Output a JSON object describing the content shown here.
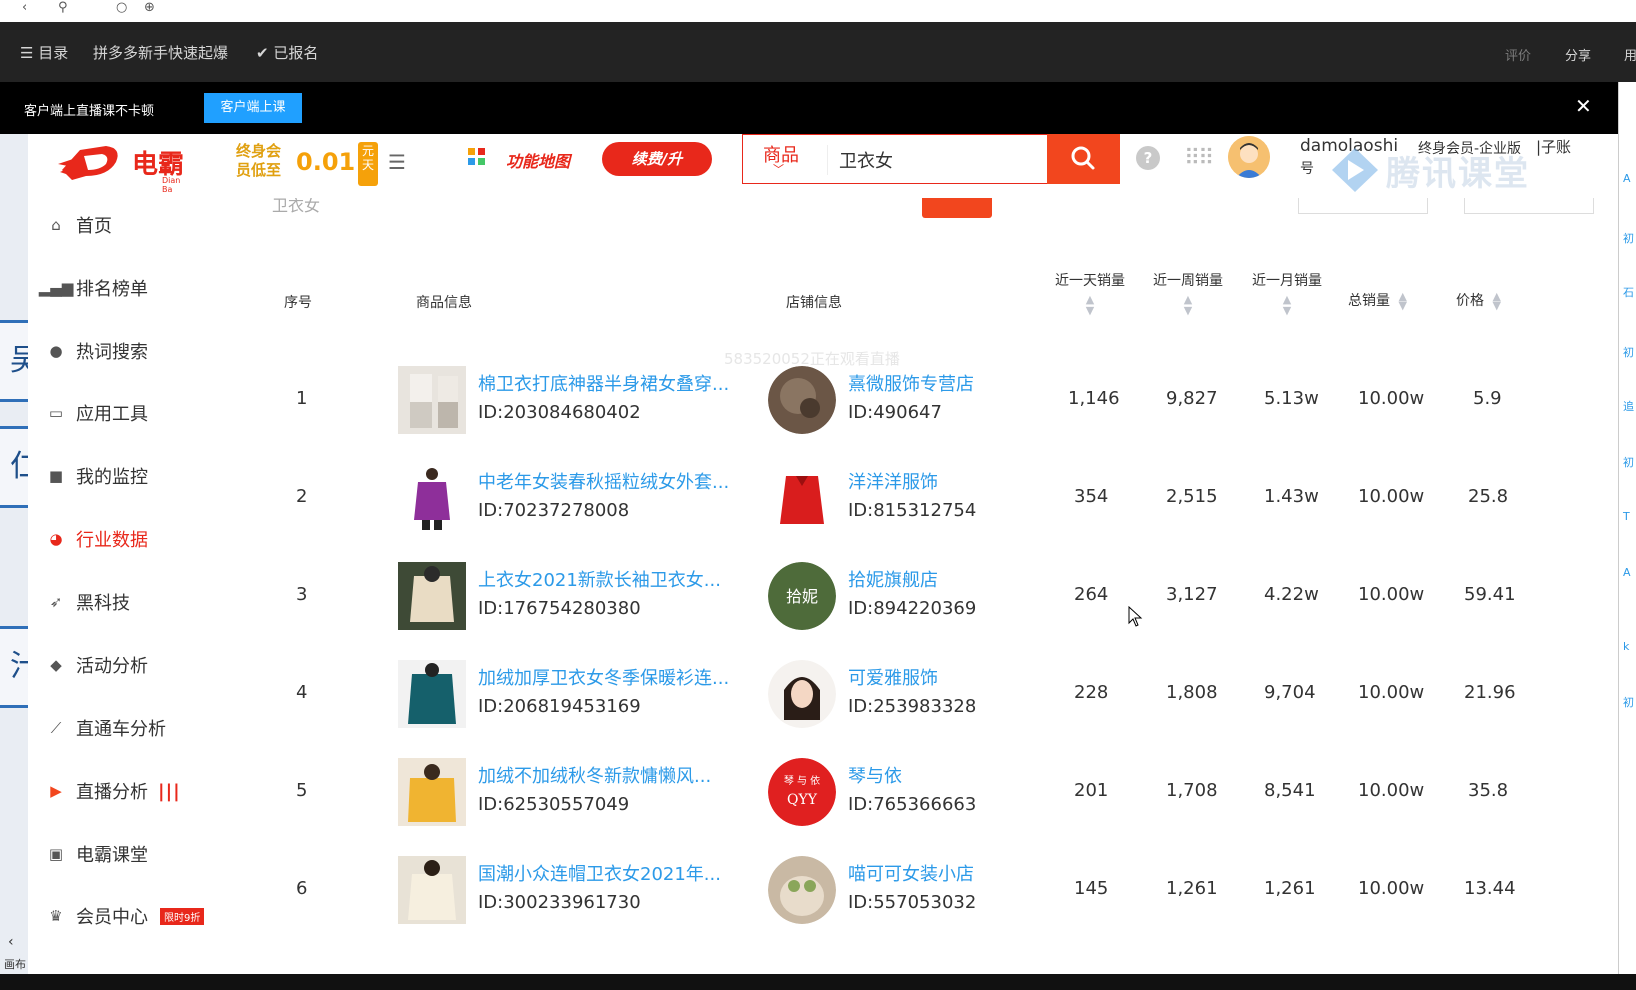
{
  "course_bar": {
    "menu": "☰ 目录",
    "title": "拼多多新手快速起爆",
    "signed": "✔ 已报名",
    "rate": "评价",
    "share": "分享",
    "more": "用"
  },
  "live_bar": {
    "tip": "客户端上直播课不卡顿",
    "button": "客户端上课",
    "close": "✕"
  },
  "left_deco": {
    "blocks": [
      "吴",
      "仁",
      "汁"
    ],
    "painting": "画布"
  },
  "header": {
    "logo_text": "电霸",
    "logo_sub": "Dian  Ba",
    "promo_line": "终身会员低至",
    "promo_price": "0.01",
    "promo_unit": "元天",
    "function_map": "功能地图",
    "renew": "续费/升",
    "search_category": "商品",
    "search_value": "卫衣女",
    "help": "?",
    "username": "damolaoshi",
    "username_suffix": "号",
    "vip": "终身会员-企业版",
    "sub_account": "|子账",
    "watermark": "腾讯课堂"
  },
  "ghost": {
    "search_echo": "卫衣女"
  },
  "sidebar": {
    "items": [
      {
        "label": "首页",
        "icon": "home-icon"
      },
      {
        "label": "排名榜单",
        "icon": "bar-chart-icon"
      },
      {
        "label": "热词搜索",
        "icon": "flame-icon"
      },
      {
        "label": "应用工具",
        "icon": "monitor-icon"
      },
      {
        "label": "我的监控",
        "icon": "camera-icon"
      },
      {
        "label": "行业数据",
        "icon": "pie-chart-icon"
      },
      {
        "label": "黑科技",
        "icon": "rocket-icon"
      },
      {
        "label": "活动分析",
        "icon": "tag-icon"
      },
      {
        "label": "直通车分析",
        "icon": "line-chart-icon"
      },
      {
        "label": "直播分析",
        "icon": "tv-icon",
        "badge": "|||"
      },
      {
        "label": "电霸课堂",
        "icon": "play-icon"
      },
      {
        "label": "会员中心",
        "icon": "crown-icon",
        "badge": "限时9折"
      }
    ],
    "active_index": 5
  },
  "table": {
    "headers": {
      "index": "序号",
      "product": "商品信息",
      "shop": "店铺信息",
      "day": "近一天销量",
      "week": "近一周销量",
      "month": "近一月销量",
      "total": "总销量",
      "price": "价格"
    },
    "watermark": "583520052正在观看直播",
    "rows": [
      {
        "index": "1",
        "name": "棉卫衣打底神器半身裙女叠穿...",
        "id": "ID:203084680402",
        "shop": "熹微服饰专营店",
        "shop_id": "ID:490647",
        "day": "1,146",
        "week": "9,827",
        "month": "5.13w",
        "total": "10.00w",
        "price": "5.9"
      },
      {
        "index": "2",
        "name": "中老年女装春秋摇粒绒女外套...",
        "id": "ID:70237278008",
        "shop": "洋洋洋服饰",
        "shop_id": "ID:815312754",
        "day": "354",
        "week": "2,515",
        "month": "1.43w",
        "total": "10.00w",
        "price": "25.8"
      },
      {
        "index": "3",
        "name": "上衣女2021新款长袖卫衣女...",
        "id": "ID:176754280380",
        "shop": "拾妮旗舰店",
        "shop_id": "ID:894220369",
        "day": "264",
        "week": "3,127",
        "month": "4.22w",
        "total": "10.00w",
        "price": "59.41"
      },
      {
        "index": "4",
        "name": "加绒加厚卫衣女冬季保暖衫连...",
        "id": "ID:206819453169",
        "shop": "可爱雅服饰",
        "shop_id": "ID:253983328",
        "day": "228",
        "week": "1,808",
        "month": "9,704",
        "total": "10.00w",
        "price": "21.96"
      },
      {
        "index": "5",
        "name": "加绒不加绒秋冬新款慵懒风...",
        "id": "ID:62530557049",
        "shop": "琴与依",
        "shop_id": "ID:765366663",
        "day": "201",
        "week": "1,708",
        "month": "8,541",
        "total": "10.00w",
        "price": "35.8"
      },
      {
        "index": "6",
        "name": "国潮小众连帽卫衣女2021年...",
        "id": "ID:300233961730",
        "shop": "喵可可女装小店",
        "shop_id": "ID:557053032",
        "day": "145",
        "week": "1,261",
        "month": "1,261",
        "total": "10.00w",
        "price": "13.44"
      }
    ]
  },
  "colors": {
    "brand_red": "#e8281b",
    "link_blue": "#2c9ae8",
    "search_orange": "#f2461e",
    "client_button": "#20a0ff"
  }
}
